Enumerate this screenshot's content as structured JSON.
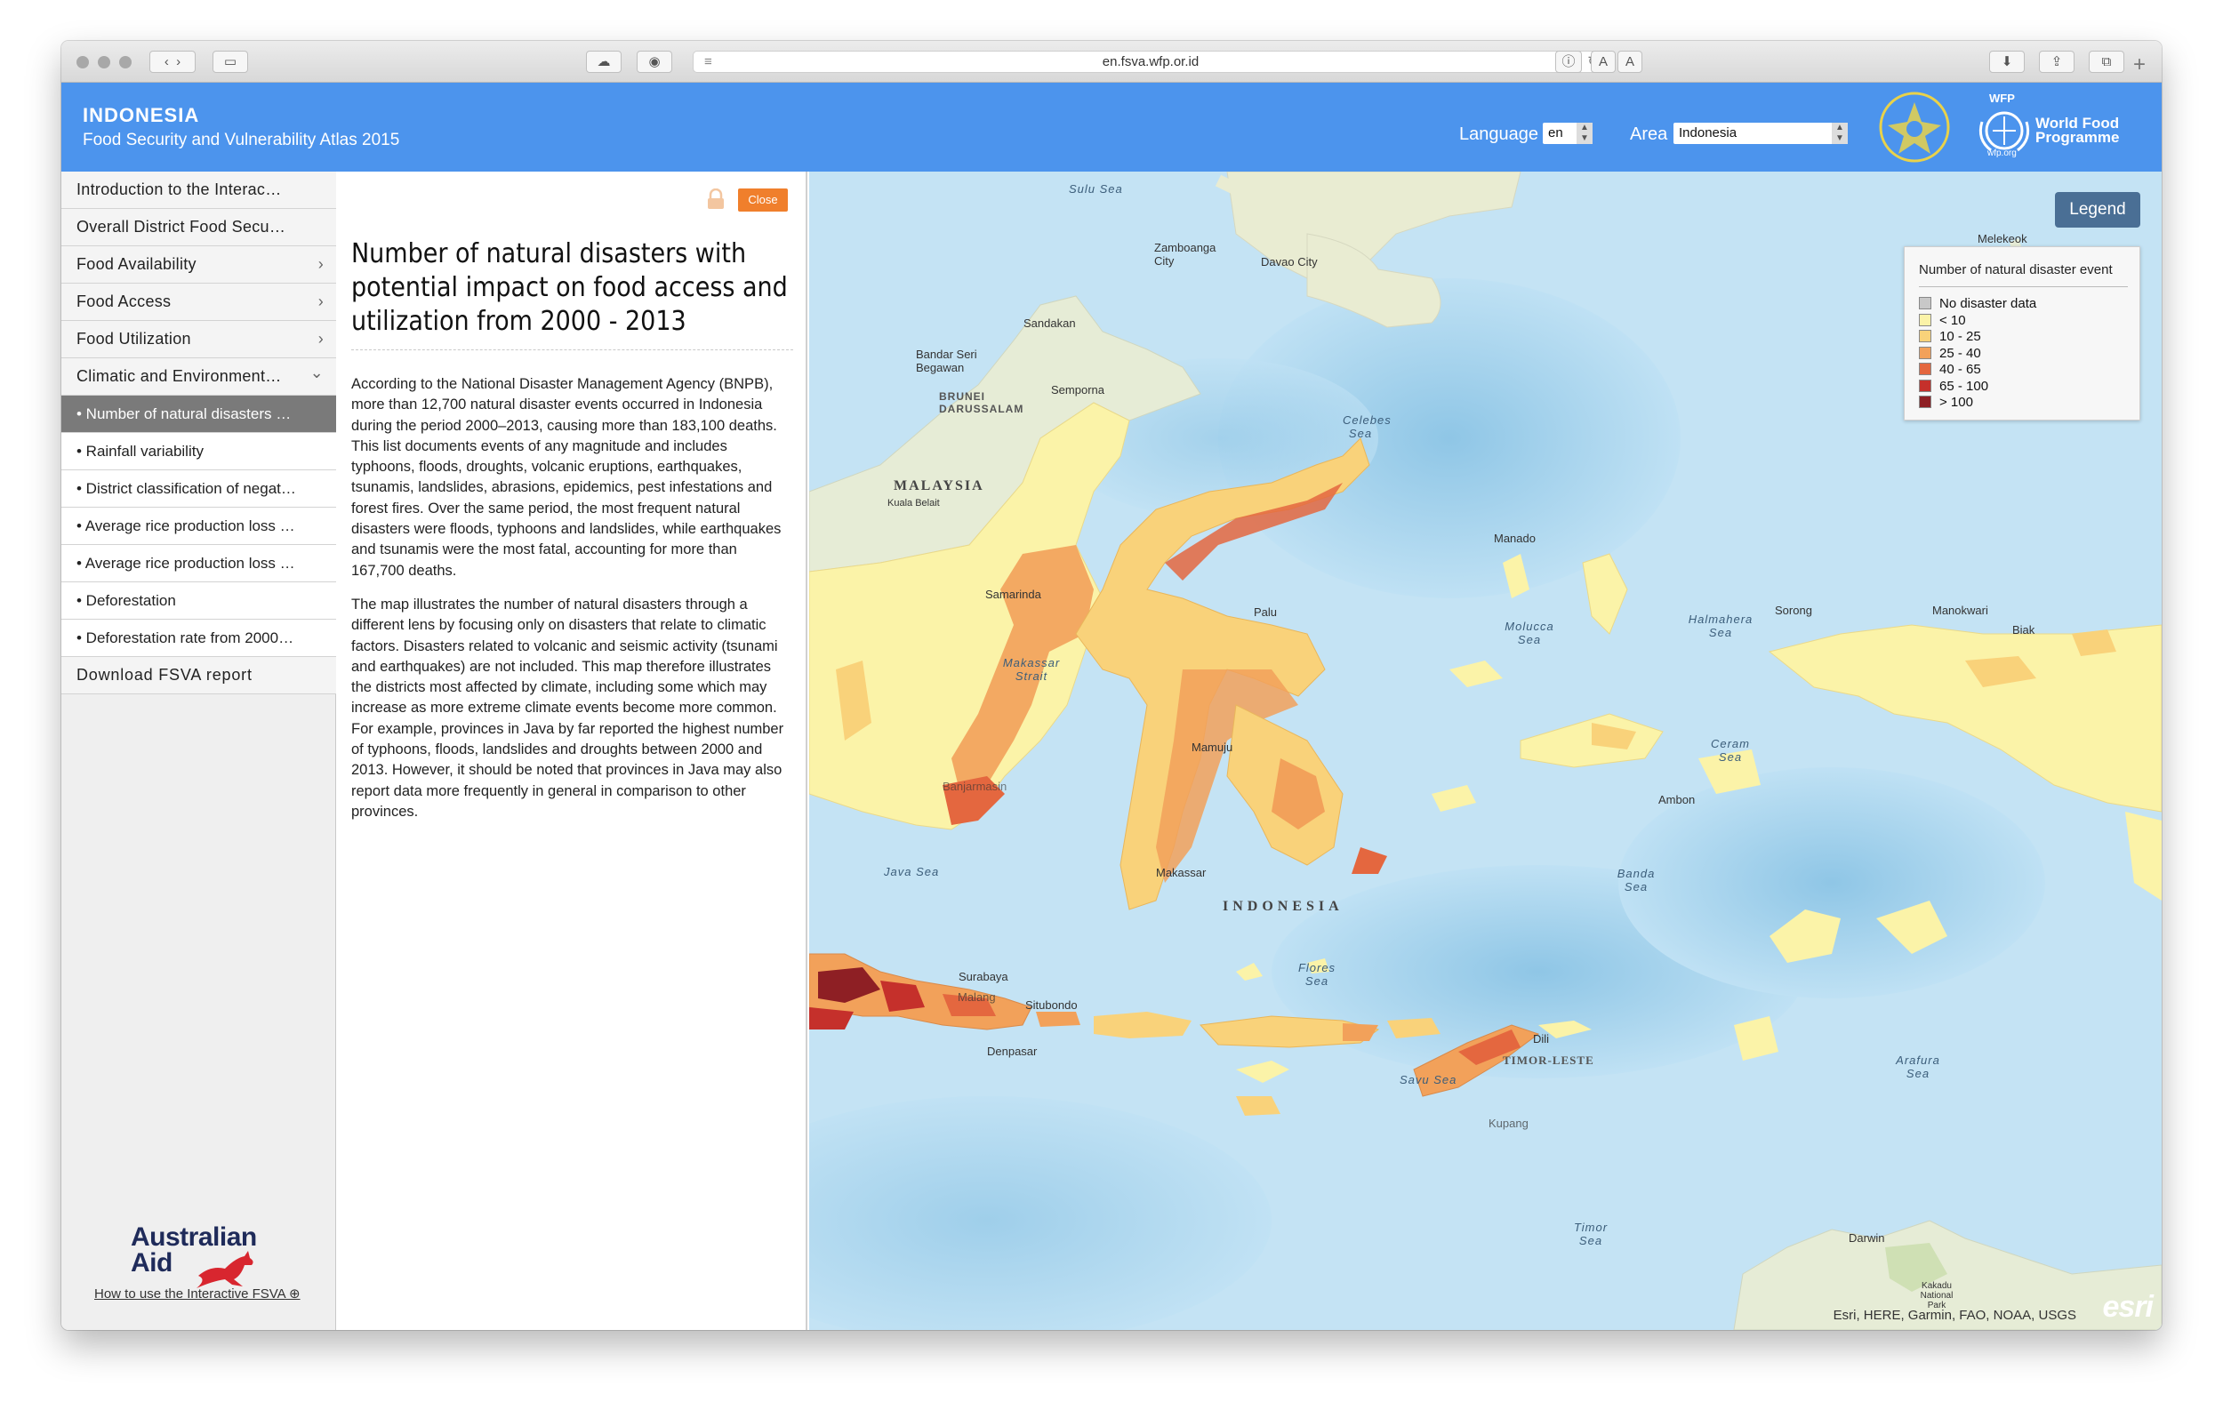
{
  "browser": {
    "url": "en.fsva.wfp.or.id",
    "reader_small": "A",
    "reader_large": "A"
  },
  "header": {
    "title": "INDONESIA",
    "subtitle": "Food Security and Vulnerability Atlas 2015",
    "language_label": "Language",
    "language_value": "en",
    "area_label": "Area",
    "area_value": "Indonesia",
    "wfp_small": "WFP",
    "wfp_name_1": "World Food",
    "wfp_name_2": "Programme",
    "wfp_url": "wfp.org"
  },
  "sidebar": {
    "items": [
      {
        "label": "Introduction to the Interac…"
      },
      {
        "label": "Overall District Food Secu…"
      },
      {
        "label": "Food Availability",
        "chevron": "›"
      },
      {
        "label": "Food Access",
        "chevron": "›"
      },
      {
        "label": "Food Utilization",
        "chevron": "›"
      },
      {
        "label": "Climatic and Environment…",
        "chevron": "⌄"
      }
    ],
    "subitems": [
      {
        "label": "• Number of natural disasters …"
      },
      {
        "label": "• Rainfall variability"
      },
      {
        "label": "• District classification of negat…"
      },
      {
        "label": "• Average rice production loss …"
      },
      {
        "label": "• Average rice production loss …"
      },
      {
        "label": "• Deforestation"
      },
      {
        "label": "• Deforestation rate from 2000…"
      }
    ],
    "download": "Download FSVA report",
    "aid_line1": "Australian",
    "aid_line2": "Aid",
    "howto": "How to use the Interactive FSVA"
  },
  "panel": {
    "close": "Close",
    "title": "Number of natural disasters with potential impact on food access and utilization from 2000 - 2013",
    "para1": "According to the National Disaster Management Agency (BNPB), more than 12,700 natural disaster events occurred in Indonesia during the period 2000–2013, causing more than 183,100 deaths. This list documents events of any magnitude and includes typhoons, floods, droughts, volcanic eruptions, earthquakes, tsunamis, landslides, abrasions, epidemics, pest infestations and forest fires. Over the same period, the most frequent natural disasters were floods, typhoons and landslides, while earthquakes and tsunamis were the most fatal, accounting for more than 167,700 deaths.",
    "para2": "The map illustrates the number of natural disasters through a different lens by focusing only on disasters that relate to climatic factors. Disasters related to volcanic and seismic activity (tsunami and earthquakes) are not included.  This map therefore illustrates the districts most affected by climate, including some which may increase as more extreme climate events become more common.  For example, provinces in Java by far reported the highest number of typhoons, floods, landslides and droughts between 2000 and 2013.  However, it should be noted that provinces in Java may also report data more frequently in general in comparison to other provinces."
  },
  "map": {
    "legend_button": "Legend",
    "legend_title": "Number of natural disaster event",
    "legend": [
      {
        "label": "No disaster data",
        "color": "#c8c8c8"
      },
      {
        "label": "< 10",
        "color": "#fbf3a8"
      },
      {
        "label": "10 - 25",
        "color": "#f9d27a"
      },
      {
        "label": "25 - 40",
        "color": "#f2a15a"
      },
      {
        "label": "40 - 65",
        "color": "#e4673f"
      },
      {
        "label": "65 - 100",
        "color": "#c5302b"
      },
      {
        "label": "> 100",
        "color": "#8e1f24"
      }
    ],
    "labels": {
      "sulu_sea": "Sulu Sea",
      "zamboanga": "Zamboanga City",
      "davao": "Davao City",
      "melekeok": "Melekeok",
      "sandakan": "Sandakan",
      "bandar": "Bandar Seri Begawan",
      "brunei": "BRUNEI DARUSSALAM",
      "semporna": "Semporna",
      "celebes": "Celebes Sea",
      "malaysia": "MALAYSIA",
      "kuala": "Kuala Belait",
      "manado": "Manado",
      "samarinda": "Samarinda",
      "palu": "Palu",
      "molucca": "Molucca Sea",
      "halmahera": "Halmahera Sea",
      "sorong": "Sorong",
      "manokwari": "Manokwari",
      "biak": "Biak",
      "makassar_strait": "Makassar Strait",
      "mamuju": "Mamuju",
      "ceram": "Ceram Sea",
      "ambon": "Ambon",
      "banjarmasin": "Banjarmasin",
      "java_sea": "Java Sea",
      "makassar": "Makassar",
      "banda": "Banda Sea",
      "indonesia": "INDONESIA",
      "flores": "Flores Sea",
      "situbondo": "Situbondo",
      "surabaya": "Surabaya",
      "malang": "Malang",
      "denpasar": "Denpasar",
      "dili": "Dili",
      "timor_leste": "TIMOR-LESTE",
      "savu": "Savu Sea",
      "kupang": "Kupang",
      "arafura": "Arafura Sea",
      "timor_sea": "Timor Sea",
      "darwin": "Darwin",
      "kakadu": "Kakadu National Park"
    },
    "attribution": "Esri, HERE, Garmin, FAO, NOAA, USGS",
    "esri": "esri"
  }
}
